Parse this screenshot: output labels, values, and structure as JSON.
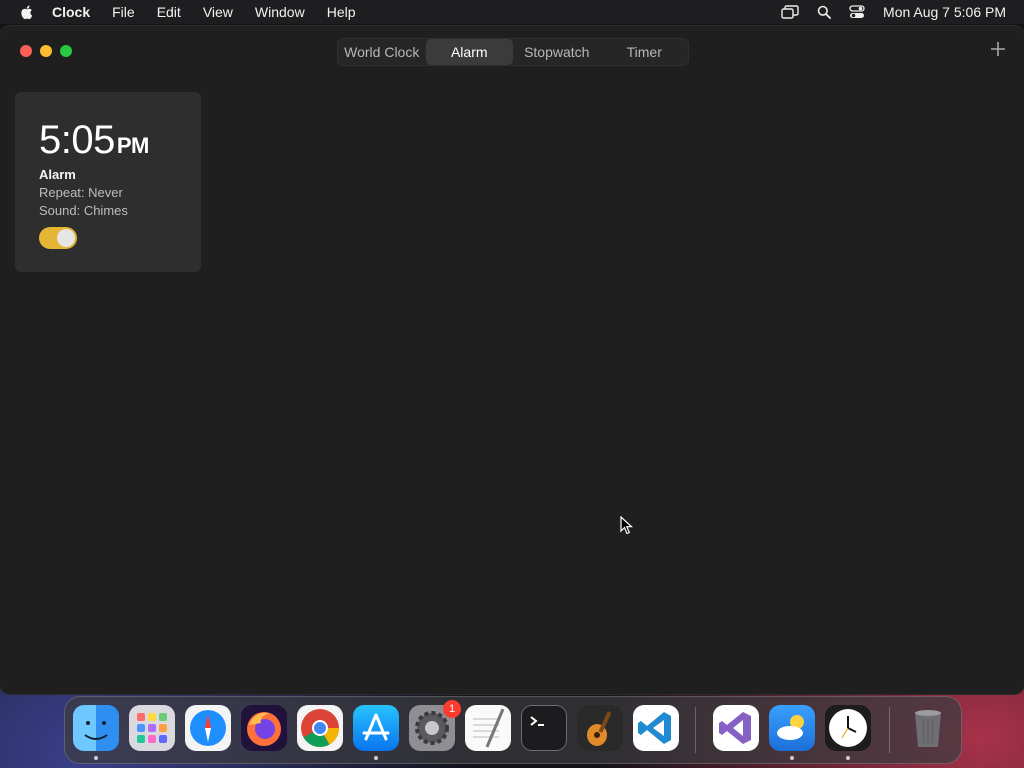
{
  "menubar": {
    "app_name": "Clock",
    "menus": [
      "File",
      "Edit",
      "View",
      "Window",
      "Help"
    ],
    "datetime": "Mon Aug 7  5:06 PM"
  },
  "tabs": [
    "World Clock",
    "Alarm",
    "Stopwatch",
    "Timer"
  ],
  "active_tab": "Alarm",
  "alarm": {
    "time": "5:05",
    "ampm": "PM",
    "label": "Alarm",
    "repeat": "Repeat: Never",
    "sound": "Sound: Chimes",
    "enabled": true
  },
  "dock": {
    "apps": [
      "Finder",
      "Launchpad",
      "Safari",
      "Firefox",
      "Chrome",
      "App Store",
      "System Settings",
      "TextEdit",
      "Terminal",
      "GarageBand",
      "Visual Studio Code",
      "Visual Studio",
      "Weather",
      "Clock",
      "Trash"
    ],
    "settings_badge": "1"
  },
  "colors": {
    "window_bg": "#1f1f1f",
    "card_bg": "#2e2e2f",
    "toggle_on": "#e5b534"
  }
}
